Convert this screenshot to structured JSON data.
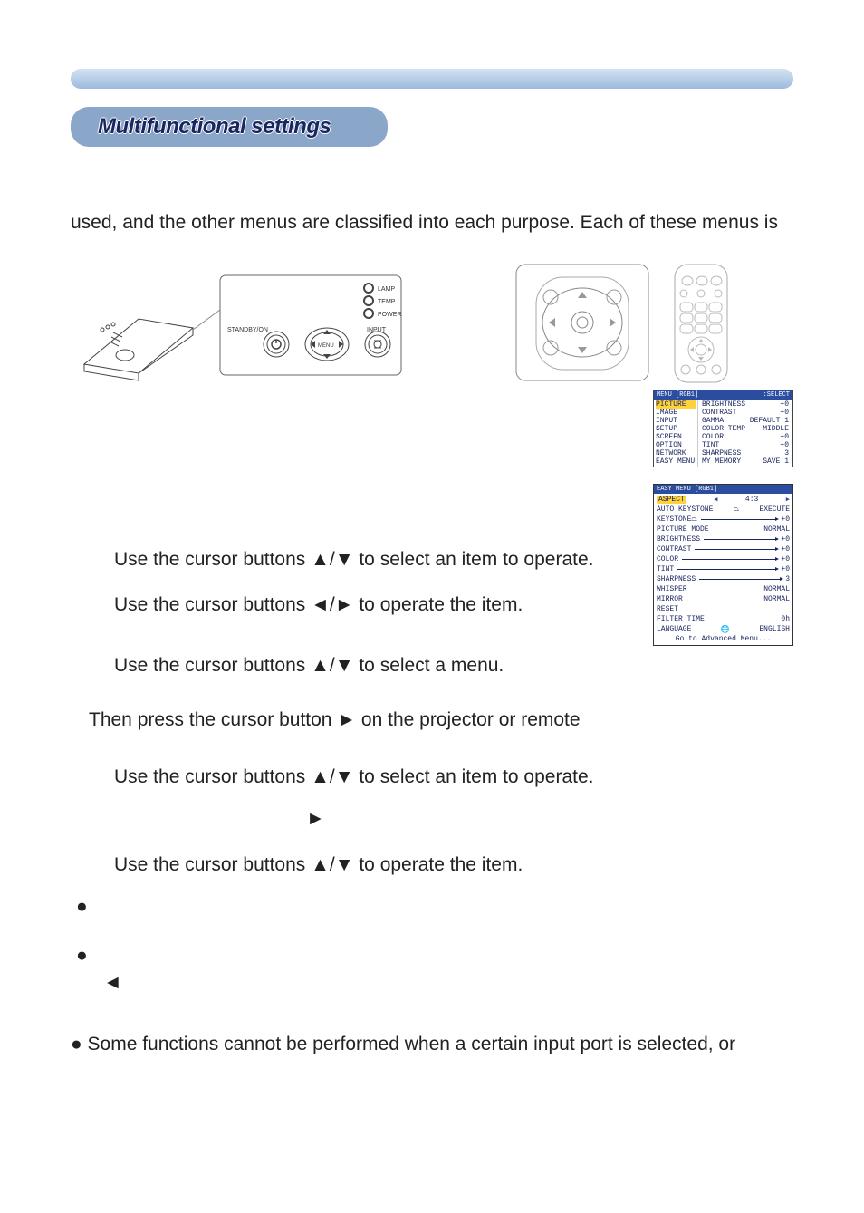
{
  "heading": "Multifunctional settings",
  "intro": "used, and the other menus are classified into each purpose. Each of these menus is",
  "panel": {
    "lamp": "LAMP",
    "temp": "TEMP",
    "power": "POWER",
    "standby": "STANDBY/ON",
    "input": "INPUT",
    "menu": "MENU"
  },
  "advmenu": {
    "header_left": "MENU [RGB1]",
    "header_right": ":SELECT",
    "left": [
      "PICTURE",
      "IMAGE",
      "INPUT",
      "SETUP",
      "SCREEN",
      "OPTION",
      "NETWORK",
      "EASY MENU"
    ],
    "right": [
      {
        "k": "BRIGHTNESS",
        "v": "+0"
      },
      {
        "k": "CONTRAST",
        "v": "+0"
      },
      {
        "k": "GAMMA",
        "v": "DEFAULT 1"
      },
      {
        "k": "COLOR TEMP",
        "v": "MIDDLE"
      },
      {
        "k": "COLOR",
        "v": "+0"
      },
      {
        "k": "TINT",
        "v": "+0"
      },
      {
        "k": "SHARPNESS",
        "v": "3"
      },
      {
        "k": "MY MEMORY",
        "v": "SAVE 1"
      }
    ]
  },
  "easymenu": {
    "header": "EASY MENU [RGB1]",
    "aspect_label": "ASPECT",
    "aspect_value": "4:3",
    "rows": [
      {
        "k": "AUTO KEYSTONE",
        "v": "EXECUTE",
        "icon": "keystone"
      },
      {
        "k": "KEYSTONE",
        "v": "+0",
        "icon": "keystone",
        "bar": true
      },
      {
        "k": "PICTURE MODE",
        "v": "NORMAL"
      },
      {
        "k": "BRIGHTNESS",
        "v": "+0",
        "bar": true
      },
      {
        "k": "CONTRAST",
        "v": "+0",
        "bar": true
      },
      {
        "k": "COLOR",
        "v": "+0",
        "bar": true
      },
      {
        "k": "TINT",
        "v": "+0",
        "bar": true
      },
      {
        "k": "SHARPNESS",
        "v": "3",
        "bar": true
      },
      {
        "k": "WHISPER",
        "v": "NORMAL"
      },
      {
        "k": "MIRROR",
        "v": "NORMAL"
      },
      {
        "k": "RESET",
        "v": ""
      },
      {
        "k": "FILTER TIME",
        "v": "0h"
      },
      {
        "k": "LANGUAGE",
        "v": "ENGLISH",
        "icon": "globe"
      }
    ],
    "footer": "Go to Advanced Menu..."
  },
  "steps": {
    "easy_sel": "Use the cursor buttons ▲/▼ to select an item to operate.",
    "easy_op": "Use the cursor buttons ◄/► to operate the item.",
    "adv_sel_menu": "Use the cursor buttons ▲/▼ to select a menu.",
    "adv_press": "Then press the cursor button ► on the projector or remote",
    "adv_sel_item": "Use the cursor buttons ▲/▼ to select an item to operate.",
    "arrow_only": "►",
    "adv_op": "Use the cursor buttons ▲/▼ to operate the item."
  },
  "bullets": {
    "dot": "●",
    "back": "◄",
    "last": "● Some functions cannot be performed when a certain input port is selected, or"
  }
}
